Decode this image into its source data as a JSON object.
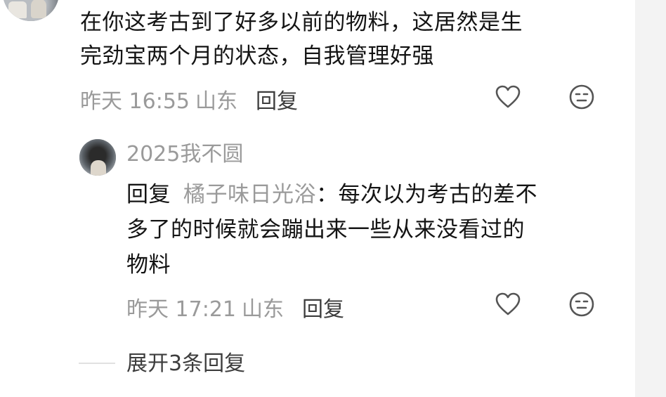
{
  "comment": {
    "text_line1": "在你这考古到了好多以前的物料，这居然是生",
    "text_line2": "完劲宝两个月的状态，自我管理好强",
    "time": "昨天 16:55",
    "location": "山东",
    "reply_label": "回复",
    "like_icon": "heart-outline-icon",
    "dislike_icon": "meh-face-icon"
  },
  "sub_reply": {
    "username": "2025我不圆",
    "prefix": "回复",
    "target_user": "橘子味日光浴",
    "text_line1": "：每次以为考古的差不",
    "text_line2": "多了的时候就会蹦出来一些从来没看过的",
    "text_line3": "物料",
    "time": "昨天 17:21",
    "location": "山东",
    "reply_label": "回复",
    "like_icon": "heart-outline-icon",
    "dislike_icon": "meh-face-icon"
  },
  "expand": {
    "label": "展开3条回复"
  },
  "colors": {
    "primary_text": "#141414",
    "secondary_text": "#9a9a9a",
    "action_text": "#3d3d3d",
    "background": "#ffffff"
  }
}
